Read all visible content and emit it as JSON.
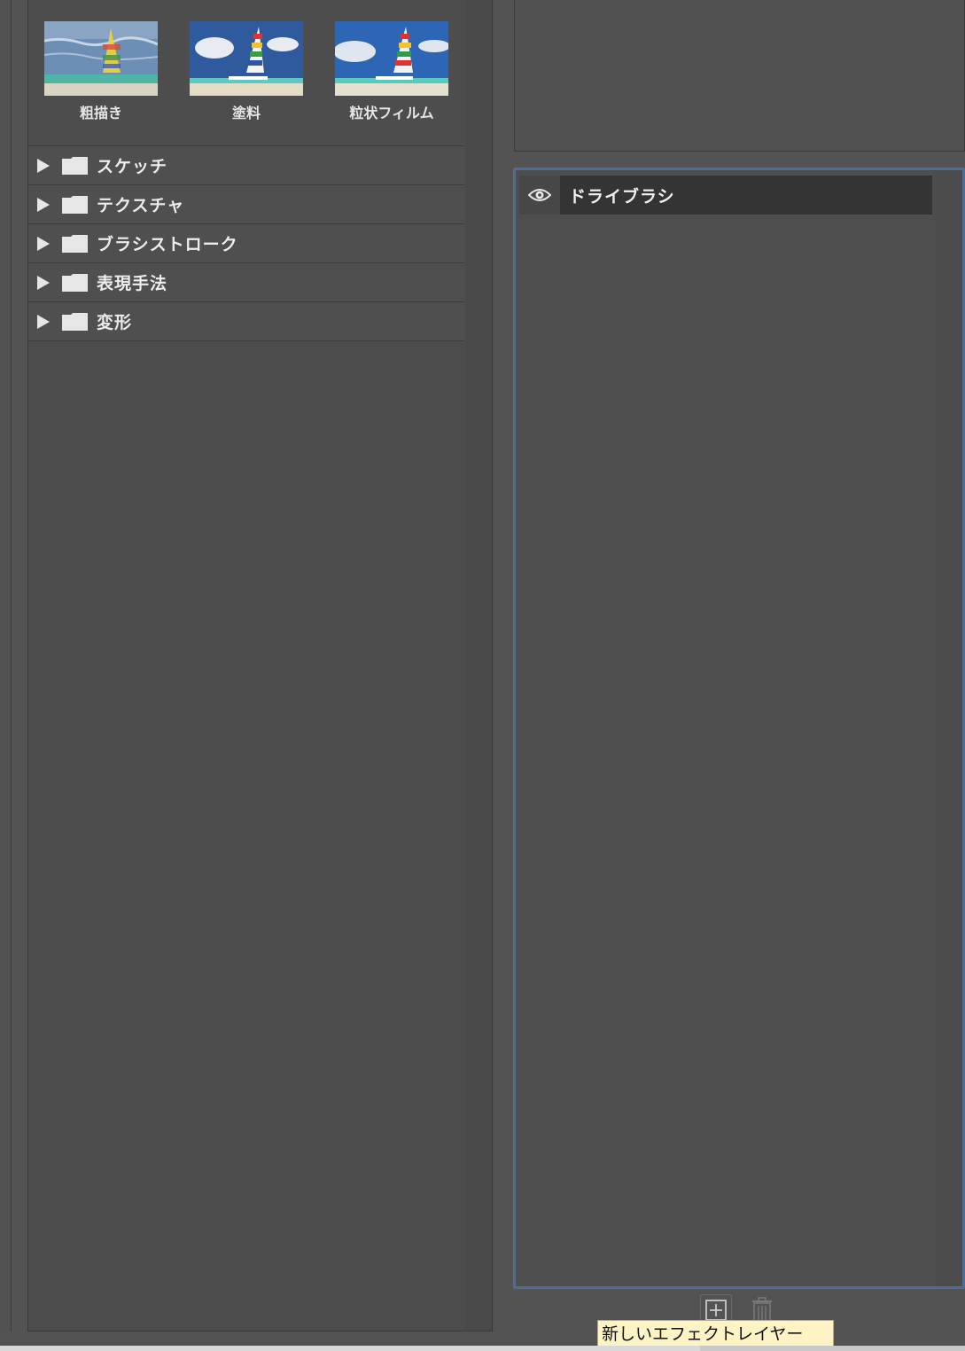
{
  "filter_gallery": {
    "thumbnails": [
      {
        "label": "粗描き"
      },
      {
        "label": "塗料"
      },
      {
        "label": "粒状フィルム"
      }
    ],
    "categories": [
      {
        "label": "スケッチ"
      },
      {
        "label": "テクスチャ"
      },
      {
        "label": "ブラシストローク"
      },
      {
        "label": "表現手法"
      },
      {
        "label": "変形"
      }
    ]
  },
  "effect_layers": {
    "items": [
      {
        "name": "ドライブラシ",
        "visible": true
      }
    ]
  },
  "tooltip": {
    "text": "新しいエフェクトレイヤー"
  },
  "colors": {
    "selection_border": "#4a6d9a",
    "tooltip_bg": "#fdf3c5"
  }
}
